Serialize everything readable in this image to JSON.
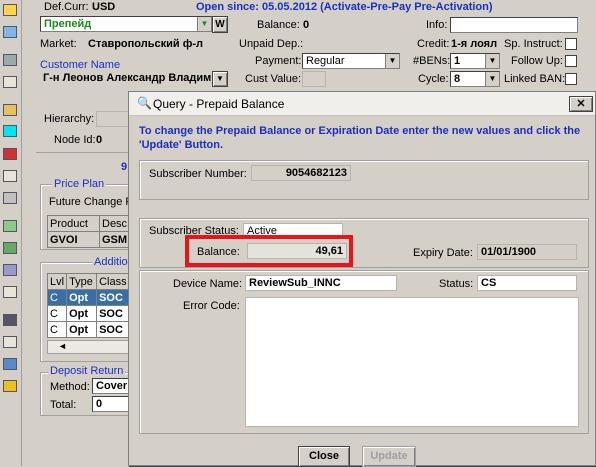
{
  "main": {
    "def_curr_label": "Def.Curr:",
    "def_curr_value": "USD",
    "open_since": "Open since: 05.05.2012 (Activate-Pre-Pay Pre-Activation)",
    "account_type": "Препейд",
    "w_button": "W",
    "market_label": "Market:",
    "market_value": "Ставропольский ф-л",
    "customer_name_label": "Customer Name",
    "customer_name_value": "Г-н Леонов Александр Владим",
    "hierarchy_label": "Hierarchy:",
    "node_id_label": "Node Id:",
    "node_id_value": "0",
    "partial_number": "9",
    "balance_label": "Balance:",
    "balance_value": "0",
    "unpaid_dep_label": "Unpaid Dep.:",
    "payment_label": "Payment:",
    "payment_value": "Regular",
    "cust_value_label": "Cust Value:",
    "info_label": "Info:",
    "credit_label": "Credit:",
    "credit_value": "1-я лоял",
    "bens_label": "#BENs:",
    "bens_value": "1",
    "cycle_label": "Cycle:",
    "cycle_value": "8",
    "sp_instruct_label": "Sp. Instruct:",
    "follow_up_label": "Follow Up:",
    "linked_ban_label": "Linked BAN:"
  },
  "price_plan": {
    "legend": "Price Plan",
    "future_change": "Future Change P",
    "headers": [
      "Product",
      "Desc"
    ],
    "row": [
      "GVOI",
      "GSM"
    ]
  },
  "additional": {
    "legend": "Additio",
    "headers": [
      "Lvl",
      "Type",
      "Class"
    ],
    "rows": [
      [
        "C",
        "Opt",
        "SOC"
      ],
      [
        "C",
        "Opt",
        "SOC"
      ],
      [
        "C",
        "Opt",
        "SOC"
      ]
    ]
  },
  "deposit": {
    "legend": "Deposit Return",
    "method_label": "Method:",
    "method_value": "Cover",
    "total_label": "Total:",
    "total_value": "0"
  },
  "dialog": {
    "title": "Query - Prepaid Balance",
    "instruction": "To change the Prepaid Balance or Expiration Date enter the new values and click the 'Update' Button.",
    "subscriber_number_label": "Subscriber Number:",
    "subscriber_number_value": "9054682123",
    "subscriber_status_label": "Subscriber Status:",
    "subscriber_status_value": "Active",
    "balance_label": "Balance:",
    "balance_value": "49,61",
    "expiry_label": "Expiry Date:",
    "expiry_value": "01/01/1900",
    "device_name_label": "Device Name:",
    "device_name_value": "ReviewSub_INNC",
    "status_label": "Status:",
    "status_value": "CS",
    "error_code_label": "Error Code:",
    "close_button": "Close",
    "update_button": "Update"
  },
  "colors": {
    "highlight": "#e8141c",
    "link_blue": "#1c2fc0",
    "account_green": "#1a8a1a"
  }
}
